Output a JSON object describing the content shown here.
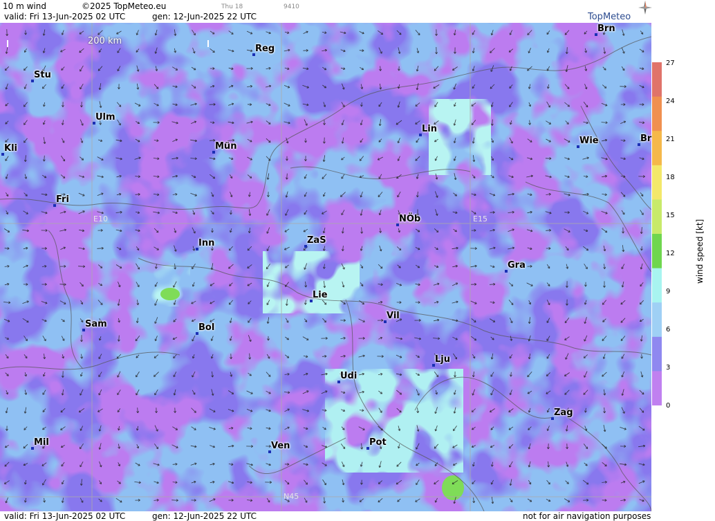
{
  "header": {
    "product": "10 m wind",
    "copyright": "©2025 TopMeteo.eu",
    "ghost_day": "Thu 18",
    "ghost_code": "9410",
    "valid": "valid:  Fri  13-Jun-2025  02 UTC",
    "gen": "gen: 12-Jun-2025 22 UTC",
    "logo": "TopMeteo"
  },
  "scale_bar": {
    "label": "200 km"
  },
  "cities": [
    {
      "name": "Brn"
    },
    {
      "name": "Reg"
    },
    {
      "name": "Stu"
    },
    {
      "name": "Ulm"
    },
    {
      "name": "Lin"
    },
    {
      "name": "Kli"
    },
    {
      "name": "Mün"
    },
    {
      "name": "Wie"
    },
    {
      "name": "Br"
    },
    {
      "name": "Fri"
    },
    {
      "name": "NÖb"
    },
    {
      "name": "Inn"
    },
    {
      "name": "ZaS"
    },
    {
      "name": "Gra"
    },
    {
      "name": "Lie"
    },
    {
      "name": "Vil"
    },
    {
      "name": "Sam"
    },
    {
      "name": "Bol"
    },
    {
      "name": "Lju"
    },
    {
      "name": "Udi"
    },
    {
      "name": "Zag"
    },
    {
      "name": "Mil"
    },
    {
      "name": "Ven"
    },
    {
      "name": "Pot"
    }
  ],
  "grid_labels": {
    "e10": "E10",
    "e15": "E15",
    "n45": "N45"
  },
  "legend": {
    "unit": "wind  speed  [kt]",
    "ticks": [
      "27",
      "24",
      "21",
      "18",
      "15",
      "12",
      "9",
      "6",
      "3",
      "0"
    ],
    "colors": [
      "#e0736a",
      "#f09050",
      "#f5b84a",
      "#f3e86a",
      "#c8ea6a",
      "#6fd64f",
      "#a8f4f0",
      "#9fd0f5",
      "#8f88f0",
      "#c080f0"
    ]
  },
  "footer": {
    "valid": "valid:  Fri  13-Jun-2025  02 UTC",
    "gen": "gen: 12-Jun-2025 22 UTC",
    "note": "not for air navigation purposes"
  }
}
